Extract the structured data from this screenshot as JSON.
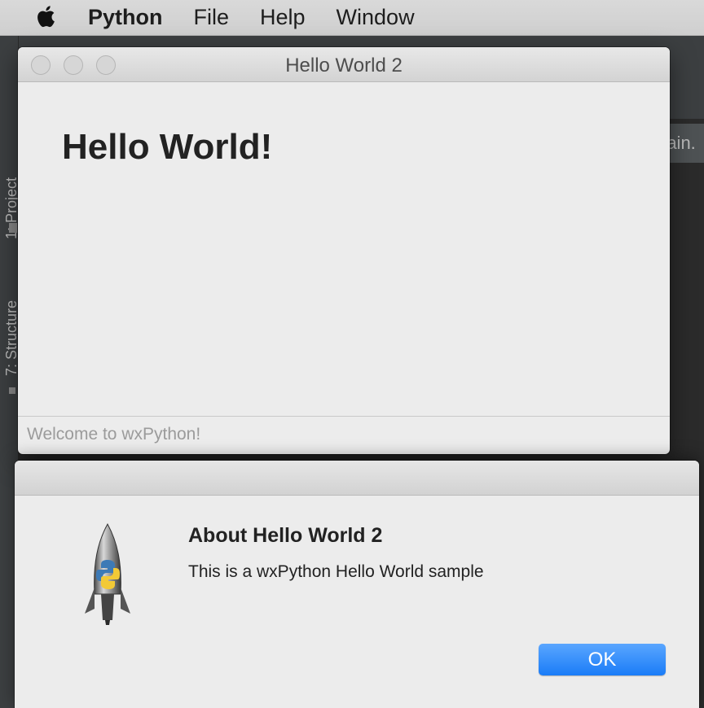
{
  "menubar": {
    "app": "Python",
    "items": [
      "File",
      "Help",
      "Window"
    ]
  },
  "ide": {
    "tab_partial": "main.",
    "sidebar_tabs": [
      "1: Project",
      "7: Structure"
    ]
  },
  "main_window": {
    "title": "Hello World 2",
    "heading": "Hello World!",
    "status": "Welcome to wxPython!"
  },
  "about_dialog": {
    "heading": "About Hello World 2",
    "message": "This is a wxPython Hello World sample",
    "ok_label": "OK",
    "icon": "python-launcher-rocket-icon"
  },
  "colors": {
    "ok_button": "#1a7cf7",
    "ide_background": "#2b2b2b"
  }
}
